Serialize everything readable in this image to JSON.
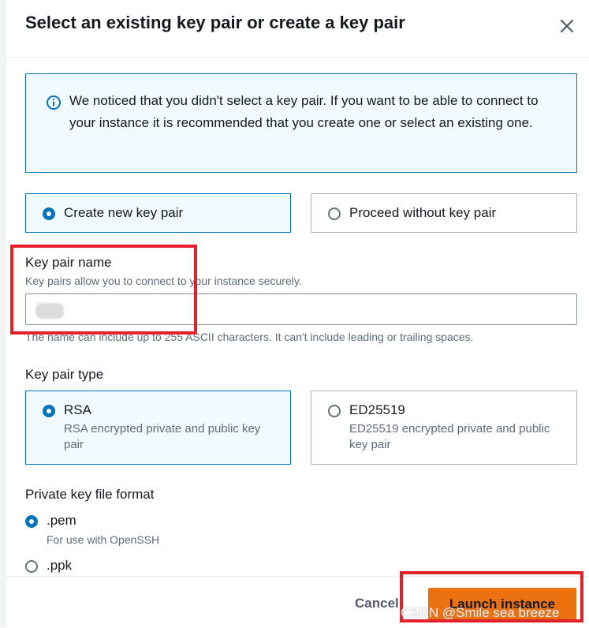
{
  "dialog": {
    "title": "Select an existing key pair or create a key pair",
    "close_icon": "close-icon"
  },
  "alert": {
    "icon": "info-icon",
    "text": "We noticed that you didn't select a key pair. If you want to be able to connect to your instance it is recommended that you create one or select an existing one."
  },
  "key_pair_choice": {
    "options": [
      {
        "label": "Create new key pair",
        "selected": true
      },
      {
        "label": "Proceed without key pair",
        "selected": false
      }
    ]
  },
  "key_pair_name": {
    "label": "Key pair name",
    "description": "Key pairs allow you to connect to your instance securely.",
    "value": "",
    "constraint": "The name can include up to 255 ASCII characters. It can't include leading or trailing spaces."
  },
  "key_pair_type": {
    "label": "Key pair type",
    "options": [
      {
        "label": "RSA",
        "description": "RSA encrypted private and public key pair",
        "selected": true
      },
      {
        "label": "ED25519",
        "description": "ED25519 encrypted private and public key pair",
        "selected": false
      }
    ]
  },
  "private_key_format": {
    "label": "Private key file format",
    "options": [
      {
        "label": ".pem",
        "description": "For use with OpenSSH",
        "selected": true
      },
      {
        "label": ".ppk",
        "description": "",
        "selected": false
      }
    ]
  },
  "footer": {
    "cancel_label": "Cancel",
    "launch_label": "Launch instance"
  },
  "watermark": "CSDN @Smile sea breeze",
  "colors": {
    "accent": "#0073bb",
    "primary_button": "#ec7211",
    "annotation_red": "#e4212b"
  }
}
